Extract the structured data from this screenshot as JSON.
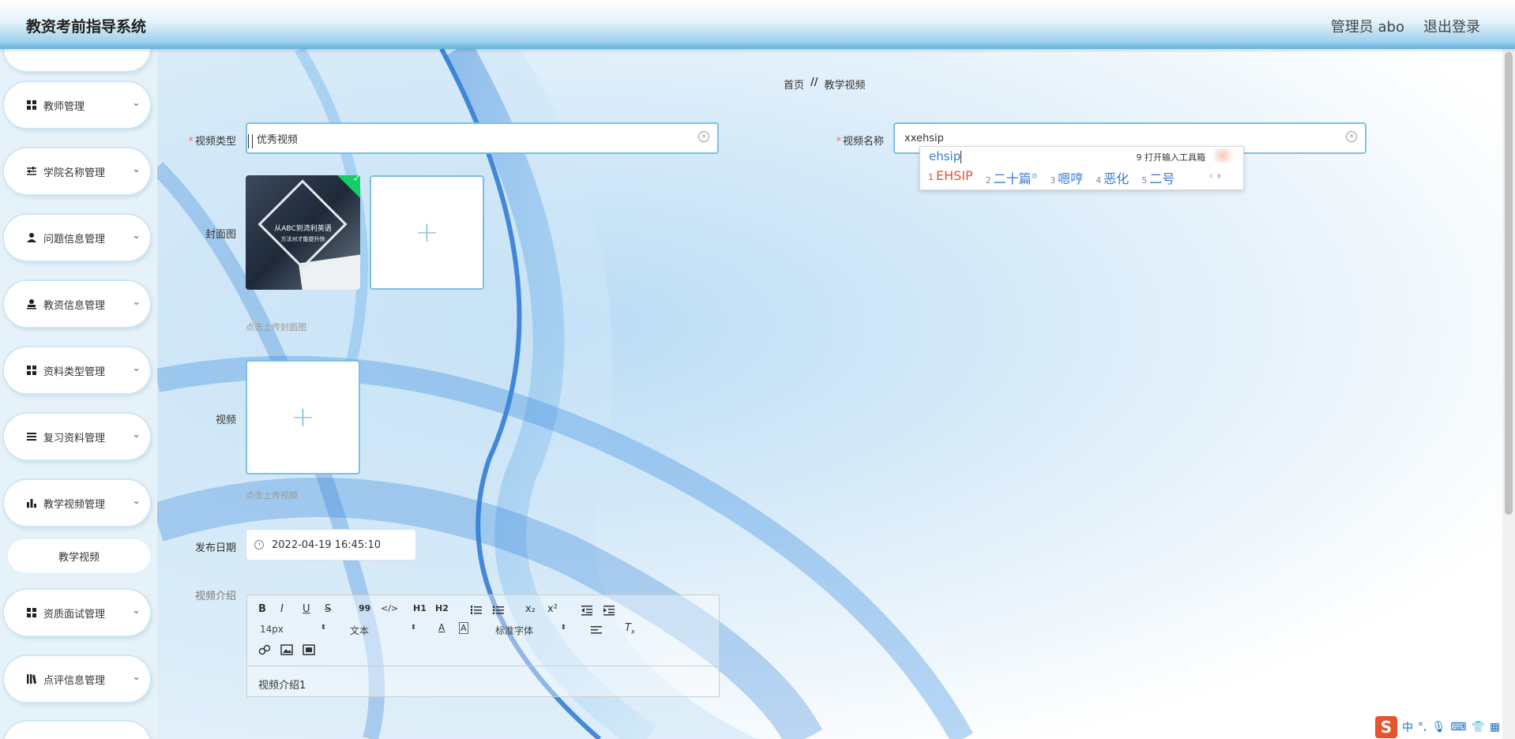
{
  "header": {
    "title": "教资考前指导系统",
    "user": "管理员 abo",
    "logout": "退出登录"
  },
  "sidebar": {
    "items": [
      {
        "label": "教师管理",
        "icon": "grid-icon"
      },
      {
        "label": "学院名称管理",
        "icon": "sliders-icon"
      },
      {
        "label": "问题信息管理",
        "icon": "user-icon"
      },
      {
        "label": "教资信息管理",
        "icon": "stamp-icon"
      },
      {
        "label": "资料类型管理",
        "icon": "grid-icon"
      },
      {
        "label": "复习资料管理",
        "icon": "list-icon"
      },
      {
        "label": "教学视频管理",
        "icon": "bar-chart-icon"
      },
      {
        "label": "资质面试管理",
        "icon": "grid-icon"
      },
      {
        "label": "点评信息管理",
        "icon": "book-icon"
      }
    ],
    "submenu": {
      "label": "教学视频"
    }
  },
  "breadcrumb": {
    "home": "首页",
    "sep": "//",
    "current": "教学视频"
  },
  "form": {
    "video_type": {
      "label": "视频类型",
      "value": "优秀视频"
    },
    "video_name": {
      "label": "视频名称",
      "value": "xxehsip"
    },
    "cover": {
      "label": "封面图",
      "hint": "点击上传封面图",
      "thumb_line1": "从ABC到流利英语",
      "thumb_line2": "方法对才能提升快"
    },
    "video": {
      "label": "视频",
      "hint": "点击上传视频"
    },
    "publish_date": {
      "label": "发布日期",
      "value": "2022-04-19 16:45:10"
    },
    "intro": {
      "label": "视频介绍",
      "content": "视频介绍1"
    }
  },
  "editor": {
    "toolbar": {
      "bold": "B",
      "italic": "I",
      "underline": "U",
      "strike": "S",
      "quote": "99",
      "code": "</>",
      "h1": "H1",
      "h2": "H2",
      "sub": "x₂",
      "sup": "x²",
      "size": "14px",
      "header": "文本",
      "font": "标准字体"
    }
  },
  "ime": {
    "composition": "ehsip",
    "tool_label": "9 打开输入工具箱",
    "candidates": [
      {
        "n": "1",
        "text": "EHSIP"
      },
      {
        "n": "2",
        "text": "二十篇"
      },
      {
        "n": "3",
        "text": "嗯哼"
      },
      {
        "n": "4",
        "text": "恶化"
      },
      {
        "n": "5",
        "text": "二号"
      }
    ]
  },
  "tray": {
    "lang": "中"
  }
}
